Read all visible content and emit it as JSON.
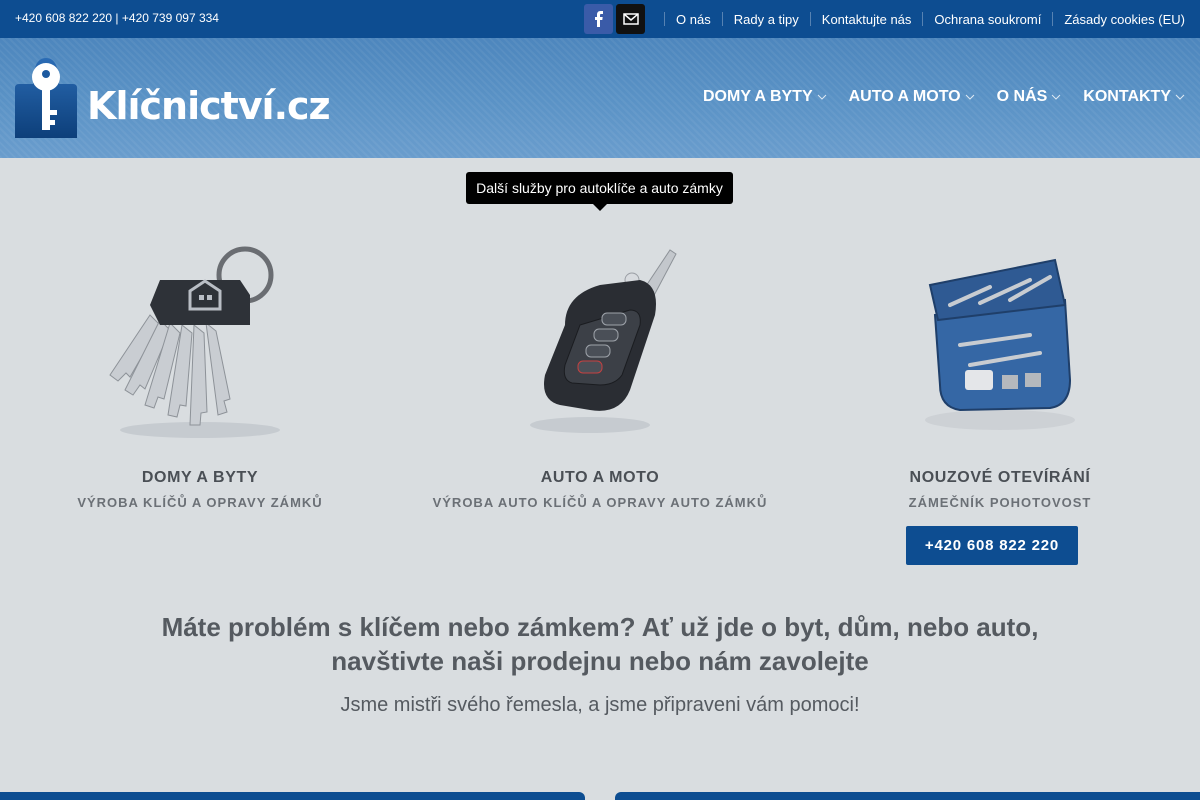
{
  "topbar": {
    "phones": "+420 608 822 220 | +420 739 097 334",
    "social": [
      "facebook-icon",
      "mail-icon"
    ],
    "links": [
      "O nás",
      "Rady a tipy",
      "Kontaktujte nás",
      "Ochrana soukromí",
      "Zásady cookies (EU)"
    ]
  },
  "header": {
    "logo_text": "Klíčnictví.cz",
    "nav": [
      "DOMY A BYTY",
      "AUTO A MOTO",
      "O NÁS",
      "KONTAKTY"
    ]
  },
  "tooltip": "Další služby pro autoklíče a auto zámky",
  "services": [
    {
      "title": "DOMY A BYTY",
      "subtitle": "VÝROBA KLÍČŮ A OPRAVY ZÁMKŮ",
      "image": "house-keys-image"
    },
    {
      "title": "AUTO A MOTO",
      "subtitle": "VÝROBA AUTO KLÍČŮ A OPRAVY AUTO ZÁMKŮ",
      "image": "car-key-fob-image"
    },
    {
      "title": "NOUZOVÉ OTEVÍRÁNÍ",
      "subtitle": "ZÁMEČNÍK POHOTOVOST",
      "image": "toolbox-image",
      "button": "+420 608 822 220"
    }
  ],
  "cta": {
    "headline_line1": "Máte problém s klíčem nebo zámkem? Ať už jde o byt, dům, nebo auto,",
    "headline_line2": "navštivte naši prodejnu nebo nám zavolejte",
    "subline": "Jsme mistři svého řemesla, a jsme připraveni vám pomoci!"
  },
  "colors": {
    "primary": "#0d4d91",
    "header": "#5b93c6",
    "background": "#d9dde0",
    "text": "#555a60"
  }
}
